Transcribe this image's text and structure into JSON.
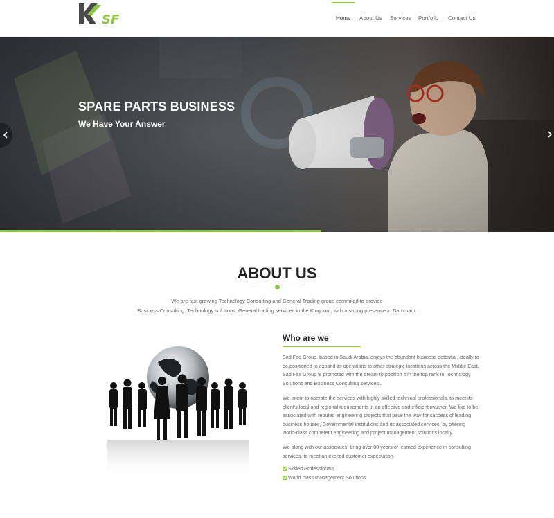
{
  "header": {
    "logo_text": "SF",
    "nav": [
      "Home",
      "About Us",
      "Services",
      "Portfolio",
      "Contact Us"
    ],
    "active_nav": "Home"
  },
  "hero": {
    "title": "SPARE PARTS BUSINESS",
    "subtitle": "We Have Your Answer",
    "slide_progress": 0.58
  },
  "about": {
    "title": "ABOUT US",
    "intro_line1": "We are fast growing Technology Consulting and General Trading group commited to provide",
    "intro_part1": "Business Consulting",
    "intro_part2": "Technology solutions",
    "intro_part3": "General trading services in the Kingdom, with a strong presence in Dammam.",
    "who_title": "Who are we",
    "para1": "Sad Faa Group, based in Saudi Arabia, enjoys the abundant business potential, ideally to be positioned to expand its operations to other strategic locations across the Middle East. Sad Faa Group is promoted with the dream to position it in the top rank in Technology Solutions and Business Consulting services..",
    "para2": "We intent to operate the services with highly skilled technical professionals, to meet its client's local and regional requirements in an effective and efficient manner. We like to be associated with reputed engineering projects that pave the way for success of leading business houses, Governmental institutions and its associated services, by offering world-class competent engineering and project management solutions locally.",
    "para3": "We along with our associates, bring over 80 years of learned experience in consulting services, to meet an exceed customer expectation.",
    "checklist": [
      "Skilled Professionals",
      "World class management Solutions"
    ]
  },
  "colors": {
    "accent": "#8dc63f",
    "dark": "#222222",
    "text": "#666666"
  }
}
